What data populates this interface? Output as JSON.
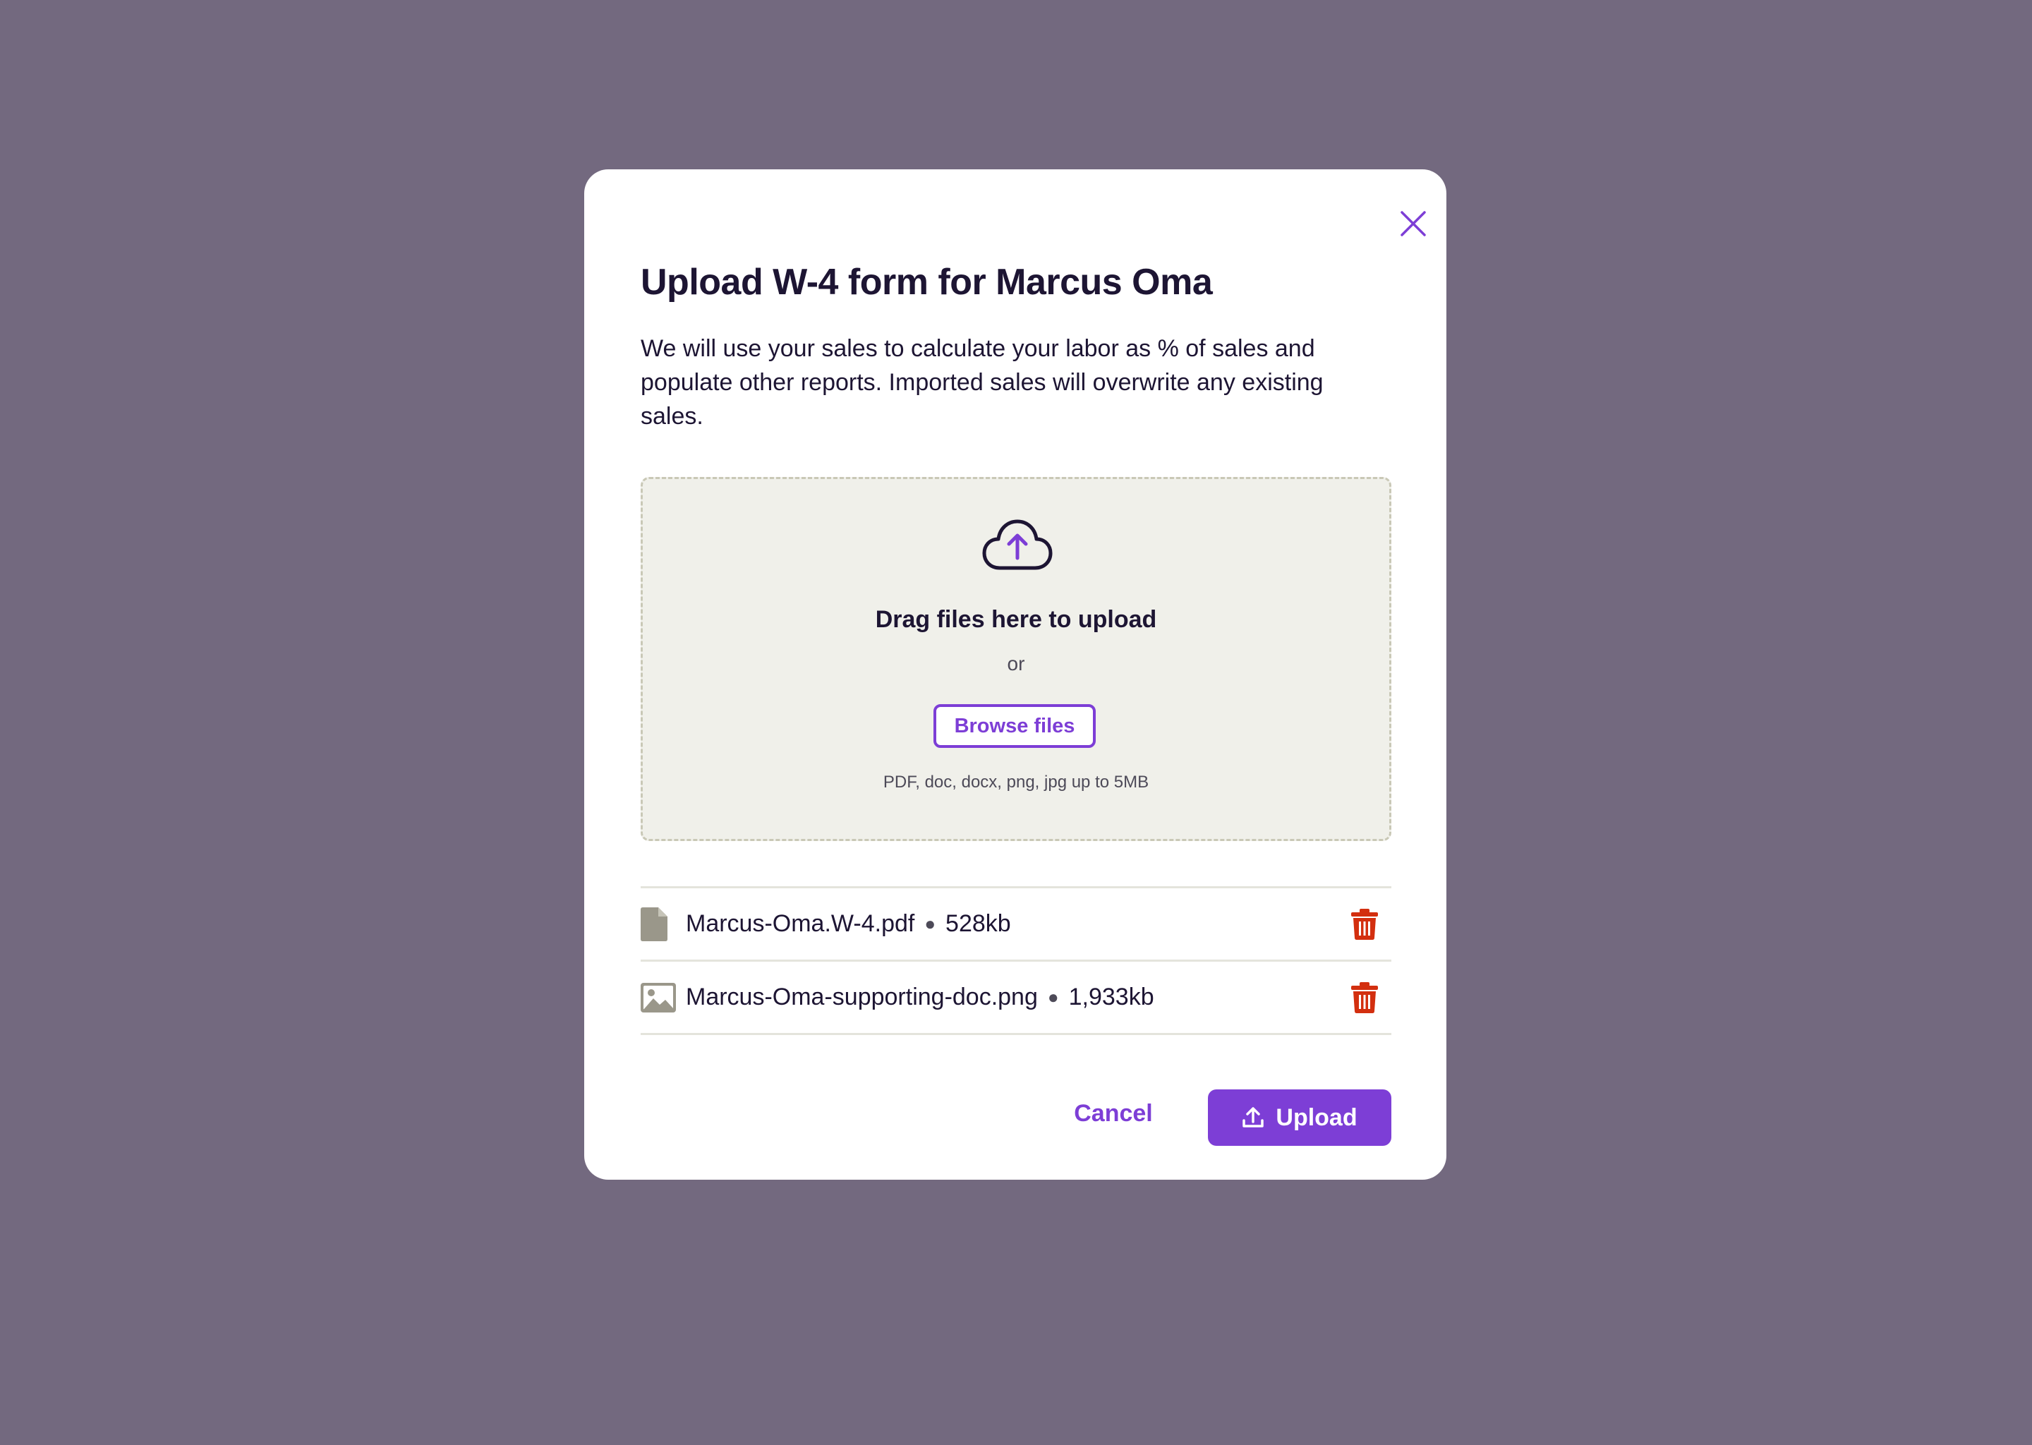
{
  "modal": {
    "title": "Upload W-4 form for Marcus Oma",
    "description": "We will use your sales to calculate your labor as % of sales and populate other reports. Imported sales will overwrite any existing sales.",
    "close_icon": "close-icon"
  },
  "dropzone": {
    "icon": "cloud-upload-icon",
    "drag_text": "Drag files here to upload",
    "or_text": "or",
    "browse_label": "Browse files",
    "hint": "PDF, doc, docx, png, jpg up to 5MB"
  },
  "files": [
    {
      "icon": "document-icon",
      "name": "Marcus-Oma.W-4.pdf",
      "size": "528kb"
    },
    {
      "icon": "image-icon",
      "name": "Marcus-Oma-supporting-doc.png",
      "size": "1,933kb"
    }
  ],
  "actions": {
    "cancel_label": "Cancel",
    "upload_label": "Upload",
    "upload_icon": "upload-icon"
  },
  "colors": {
    "backdrop": "#73697f",
    "accent": "#7d3ed6",
    "danger": "#d32f0f",
    "dropzone_bg": "#f0f0ea",
    "file_icon": "#9a978a"
  }
}
